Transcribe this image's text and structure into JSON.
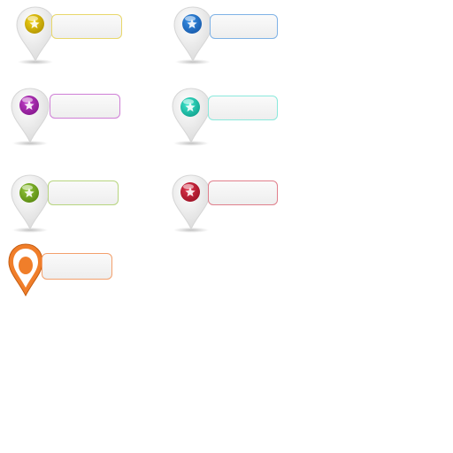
{
  "markers": [
    {
      "style": "glossy",
      "icon": "star-icon",
      "color": "#f4d313",
      "color_dark": "#b89a05",
      "border": "#e8d76a"
    },
    {
      "style": "glossy",
      "icon": "star-icon",
      "color": "#3a92e8",
      "color_dark": "#1a5fb0",
      "border": "#7fb2e6"
    },
    {
      "style": "glossy",
      "icon": "star-icon",
      "color": "#c23fc9",
      "color_dark": "#8a1a92",
      "border": "#cf7fd6"
    },
    {
      "style": "glossy",
      "icon": "star-icon",
      "color": "#3fe8cf",
      "color_dark": "#14a893",
      "border": "#8ae9dc"
    },
    {
      "style": "glossy",
      "icon": "star-icon",
      "color": "#93c83a",
      "color_dark": "#5e8e14",
      "border": "#b7d57f"
    },
    {
      "style": "glossy",
      "icon": "star-icon",
      "color": "#e0354d",
      "color_dark": "#a11428",
      "border": "#e07f8c"
    },
    {
      "style": "flat",
      "icon": "map-pin-icon",
      "color": "#f07e2a",
      "color_dark": "#c45a0e",
      "border": "#f3a06c"
    }
  ]
}
